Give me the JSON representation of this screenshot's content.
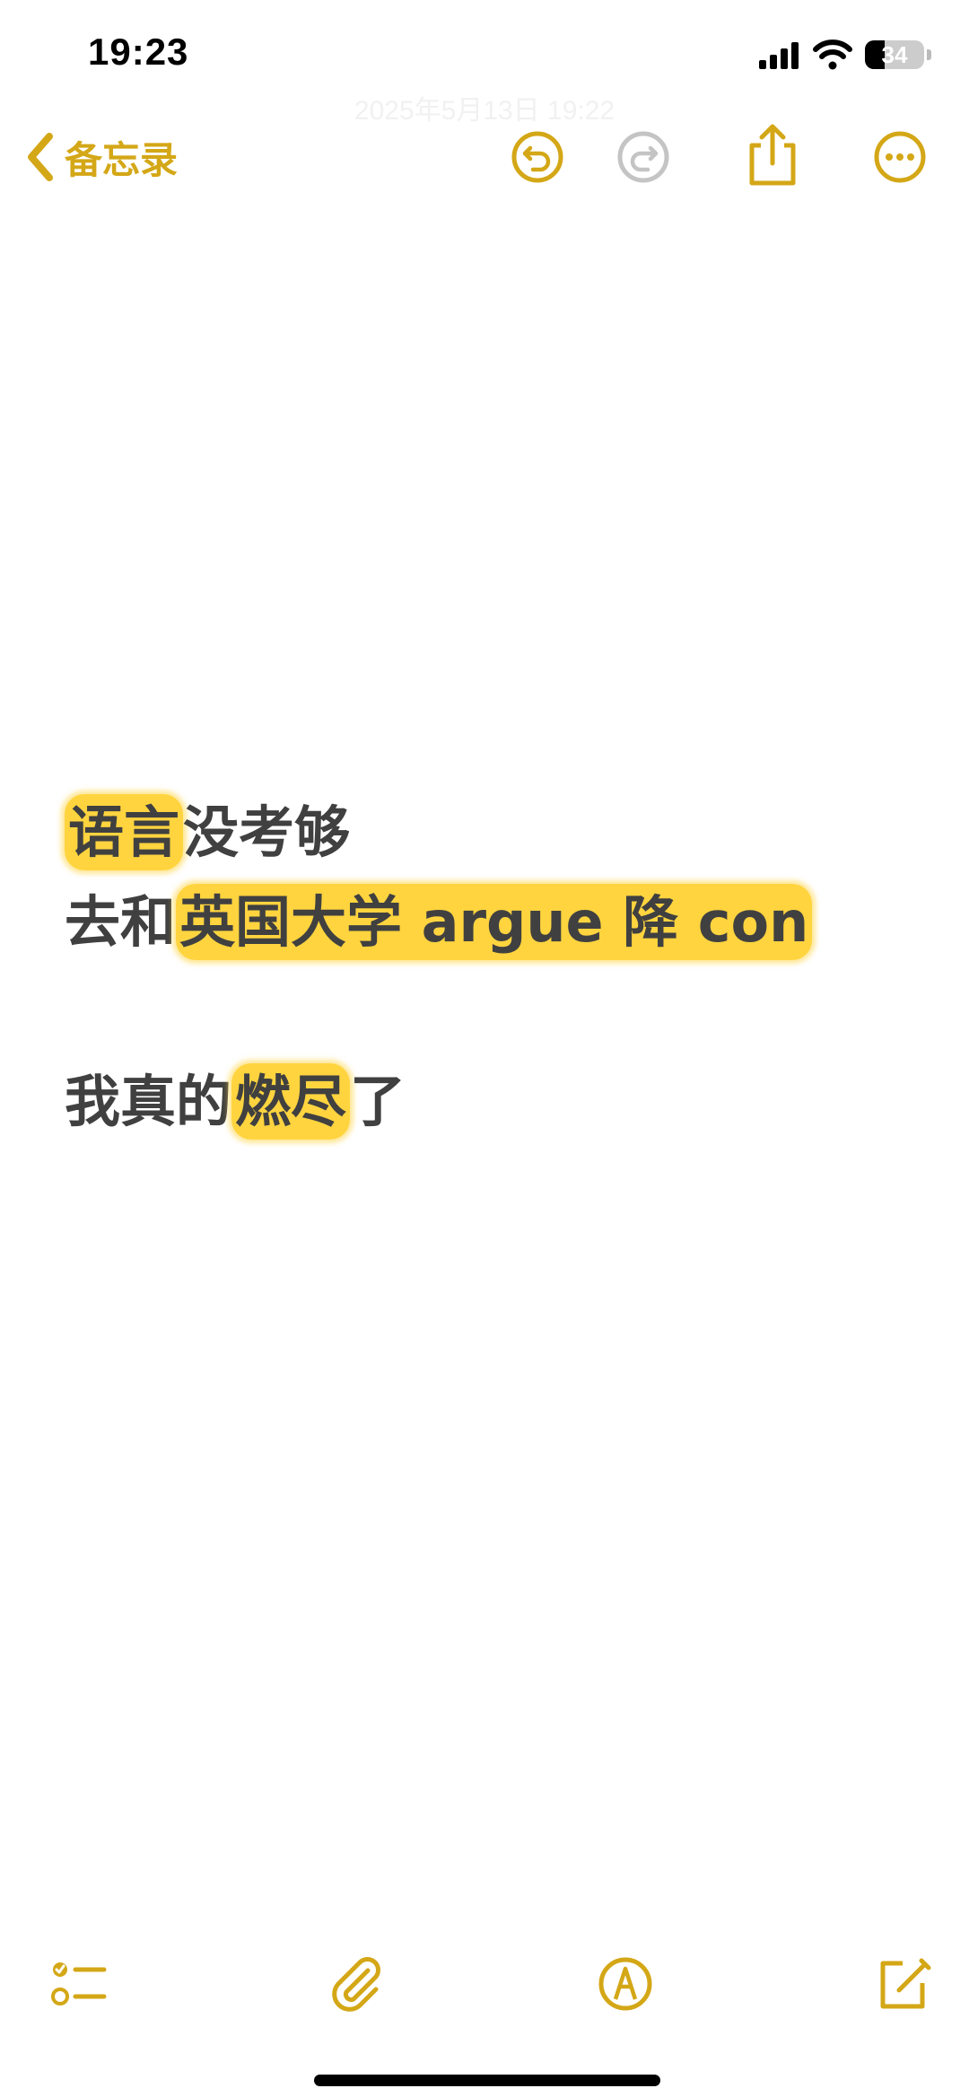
{
  "status_bar": {
    "time": "19:23",
    "battery_percent": "34",
    "battery_level": 0.34
  },
  "header": {
    "faded_date": "2025年5月13日 19:22"
  },
  "nav": {
    "back_label": "备忘录"
  },
  "note": {
    "line1": {
      "highlight": "语言",
      "rest": "没考够"
    },
    "line2": {
      "prefix": "去和",
      "highlight": "英国大学 argue 降 con"
    },
    "line3": {
      "prefix": "我真的",
      "highlight": "燃尽",
      "suffix": "了"
    }
  },
  "colors": {
    "accent": "#d4a717",
    "highlight": "#ffd43f",
    "text": "#404040",
    "disabled": "#c4c4c4"
  },
  "icons": {
    "back": "chevron-left-icon",
    "undo": "undo-icon",
    "redo": "redo-icon",
    "share": "share-icon",
    "more": "ellipsis-icon",
    "checklist": "checklist-icon",
    "attachment": "paperclip-icon",
    "markup": "markup-pen-icon",
    "compose": "compose-icon"
  }
}
